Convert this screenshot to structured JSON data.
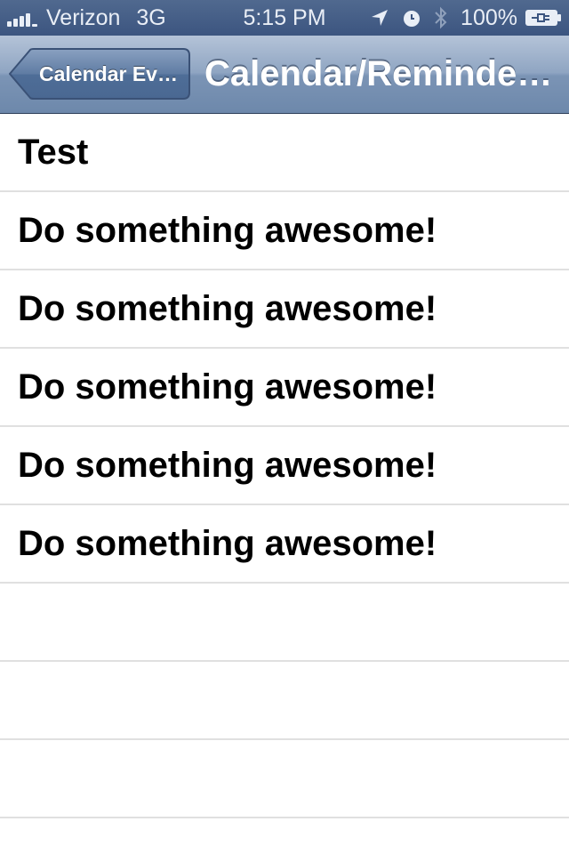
{
  "status_bar": {
    "carrier": "Verizon",
    "network": "3G",
    "time": "5:15 PM",
    "battery": "100%",
    "icons": [
      "signal-bars-icon",
      "location-arrow-icon",
      "alarm-clock-icon",
      "bluetooth-icon",
      "battery-charging-icon"
    ]
  },
  "nav": {
    "back_label": "Calendar Ev…",
    "title": "Calendar/Reminde…"
  },
  "table": {
    "rows": [
      {
        "label": "Test"
      },
      {
        "label": "Do something awesome!"
      },
      {
        "label": "Do something awesome!"
      },
      {
        "label": "Do something awesome!"
      },
      {
        "label": "Do something awesome!"
      },
      {
        "label": "Do something awesome!"
      }
    ]
  },
  "colors": {
    "status_bar": "#3c5580",
    "nav_bar_top": "#b4c3d8",
    "nav_bar_bottom": "#6d88ab",
    "separator": "#e0e0e0"
  }
}
